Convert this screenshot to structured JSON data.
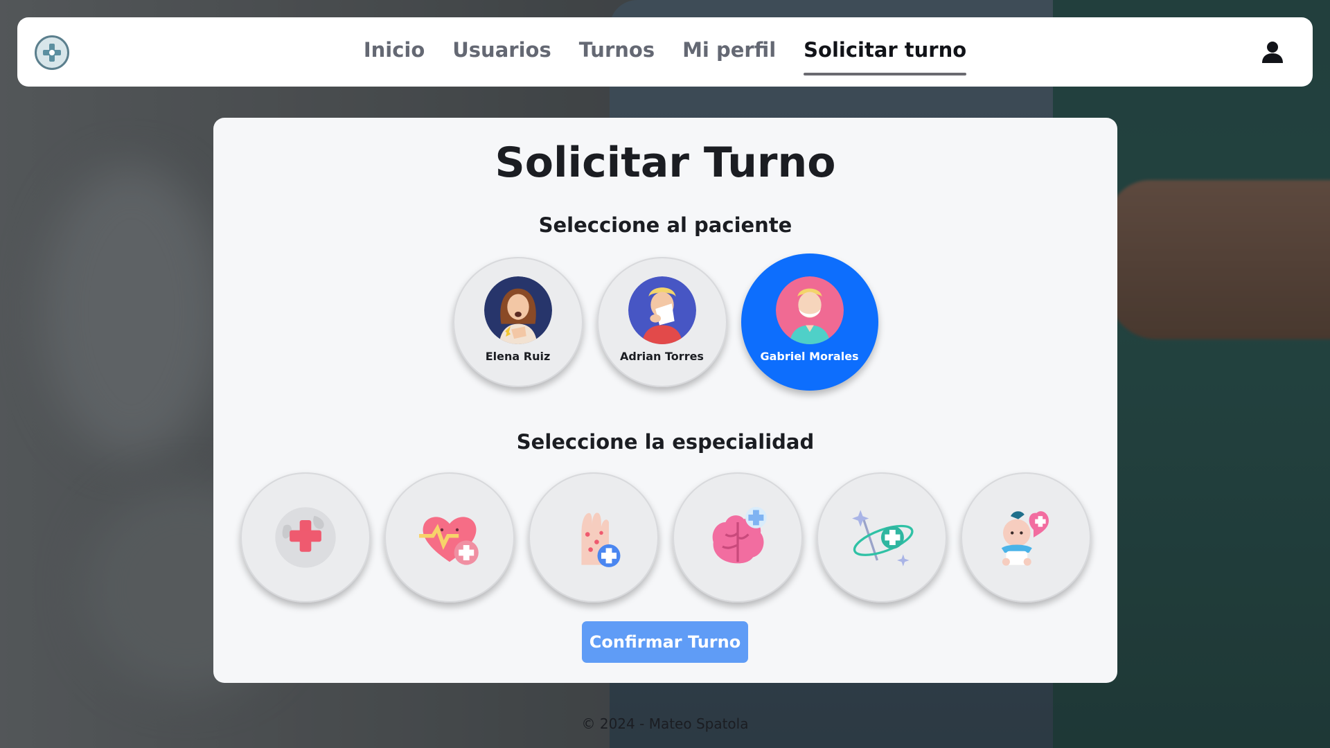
{
  "nav": {
    "items": [
      {
        "label": "Inicio",
        "active": false
      },
      {
        "label": "Usuarios",
        "active": false
      },
      {
        "label": "Turnos",
        "active": false
      },
      {
        "label": "Mi perfil",
        "active": false
      },
      {
        "label": "Solicitar turno",
        "active": true
      }
    ],
    "logo_icon": "medical-cross-logo-icon",
    "user_icon": "user-icon"
  },
  "main": {
    "title": "Solicitar Turno",
    "patient_heading": "Seleccione al paciente",
    "patients": [
      {
        "name": "Elena Ruiz",
        "selected": false,
        "icon": "patient-woman-coughing-icon"
      },
      {
        "name": "Adrian Torres",
        "selected": false,
        "icon": "patient-man-sneezing-icon"
      },
      {
        "name": "Gabriel Morales",
        "selected": true,
        "icon": "patient-elderly-man-icon"
      }
    ],
    "specialty_heading": "Seleccione la especialidad",
    "specialties": [
      {
        "icon": "medical-globe-icon"
      },
      {
        "icon": "cardiology-heart-icon"
      },
      {
        "icon": "dermatology-hand-icon"
      },
      {
        "icon": "neurology-brain-icon"
      },
      {
        "icon": "orbit-health-icon"
      },
      {
        "icon": "pediatrics-baby-icon"
      }
    ],
    "confirm_label": "Confirmar Turno"
  },
  "footer": {
    "text": "© 2024 - Mateo Spatola"
  },
  "colors": {
    "accent": "#0d6efd",
    "confirm_button": "#5f9cf6",
    "card_background": "#f6f7f9"
  }
}
